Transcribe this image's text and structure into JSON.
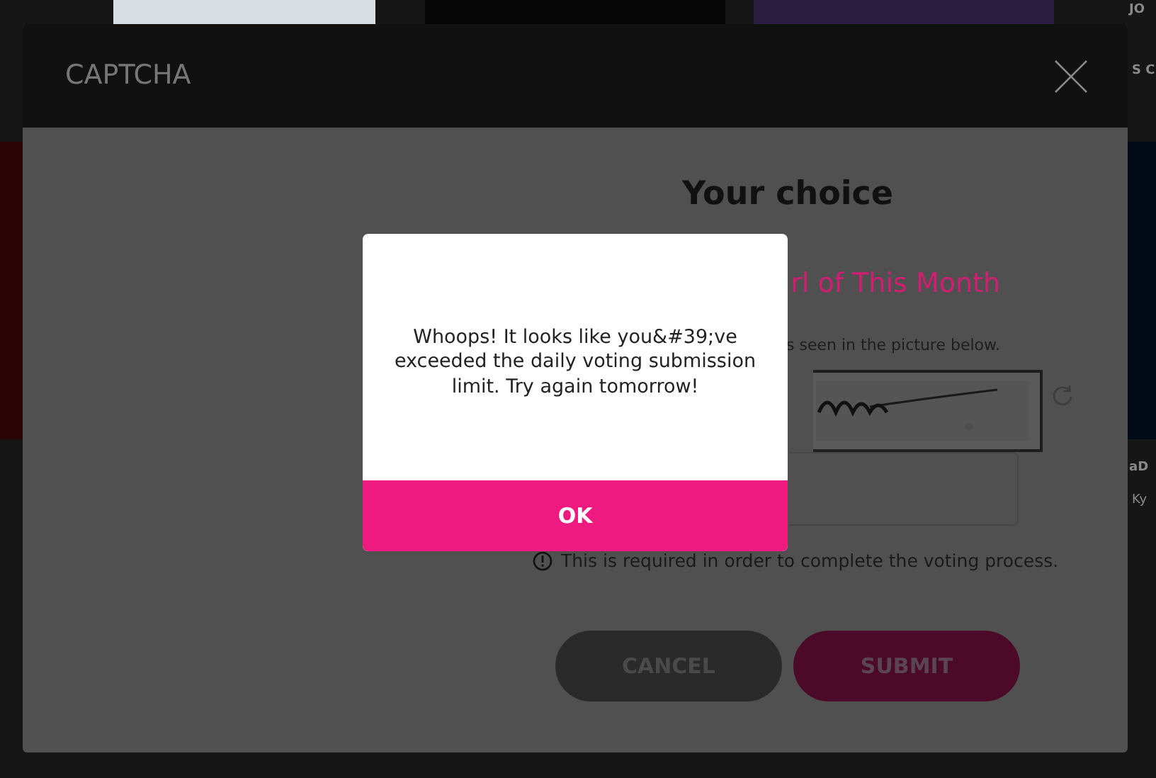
{
  "background_page": {
    "texts": [
      "JO",
      "S C",
      "aD",
      "Ky"
    ]
  },
  "captcha_dialog": {
    "title": "CAPTCHA",
    "heading": "Your choice",
    "subheading": "rl of This Month",
    "instruction": "s seen in the picture below.",
    "note": "This is required in order to complete the voting process.",
    "buttons": [
      {
        "label": "CANCEL",
        "kind": "secondary"
      },
      {
        "label": "SUBMIT",
        "kind": "primary"
      }
    ]
  },
  "alert": {
    "message": "Whoops! It looks like you&#39;ve exceeded the daily voting submission limit. Try again tomorrow!",
    "button": "OK"
  }
}
